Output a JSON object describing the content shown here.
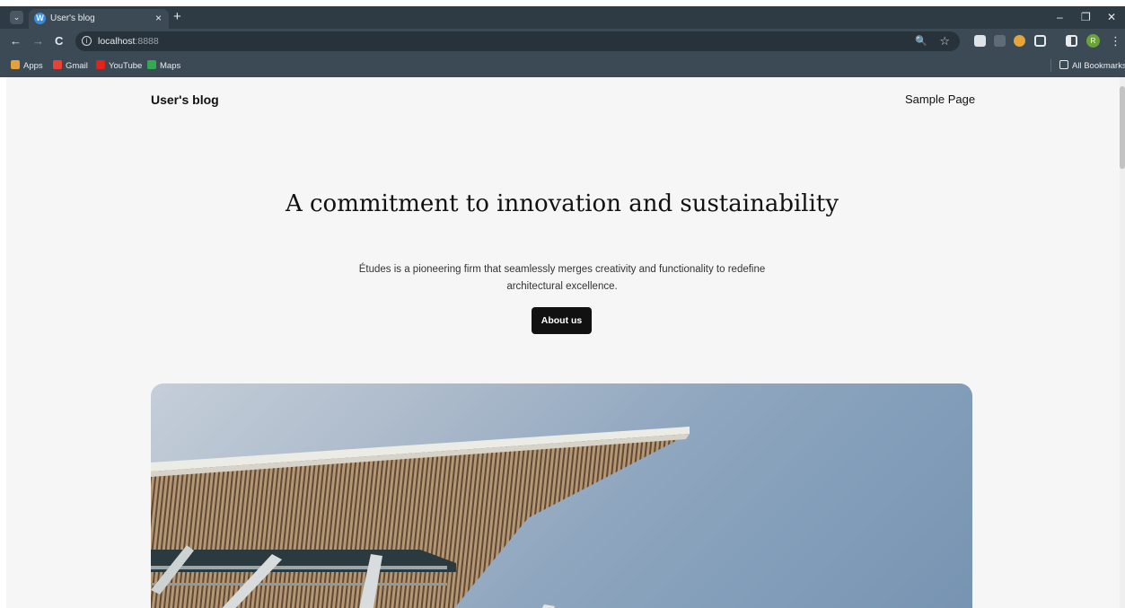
{
  "browser": {
    "tab": {
      "title": "User's blog",
      "favicon": "wordpress-icon",
      "close": "×"
    },
    "new_tab": "+",
    "window_controls": {
      "minimize": "–",
      "restore": "❐",
      "close": "✕"
    },
    "toolbar": {
      "back": "←",
      "forward": "→",
      "reload": "C",
      "url_host": "localhost",
      "url_port": ":8888",
      "info_icon": "i",
      "zoom_icon": "🔍",
      "star_icon": "☆",
      "menu": "⋮",
      "profile_initial": "R"
    },
    "bookmarks": [
      {
        "label": "Apps",
        "color": "#e2a13b"
      },
      {
        "label": "Gmail",
        "color": "#ea4335"
      },
      {
        "label": "YouTube",
        "color": "#e62117"
      },
      {
        "label": "Maps",
        "color": "#34a853"
      }
    ],
    "all_bookmarks": "All Bookmarks"
  },
  "page": {
    "site_title": "User's blog",
    "nav": {
      "sample_page": "Sample Page"
    },
    "hero": {
      "heading": "A commitment to innovation and sustainability",
      "text": "Études is a pioneering firm that seamlessly merges creativity and functionality to redefine architectural excellence.",
      "button": "About us"
    }
  }
}
